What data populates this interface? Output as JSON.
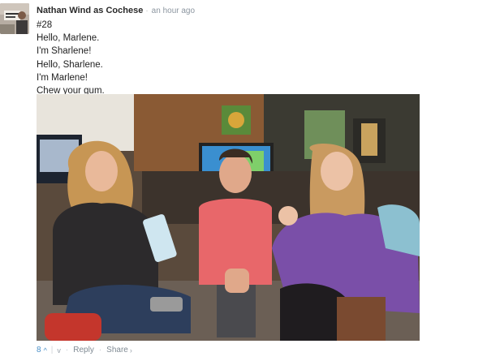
{
  "comment": {
    "author": "Nathan Wind as Cochese",
    "separator": "·",
    "timestamp": "an hour ago",
    "lines": [
      "#28",
      "Hello, Marlene.",
      "I'm Sharlene!",
      "Hello, Sharlene.",
      "I'm Marlene!",
      "Chew your gum."
    ],
    "avatar_icon": "user-avatar-photo",
    "image_icon": "embedded-photo"
  },
  "footer": {
    "vote_count": "8",
    "upvote_glyph": "^",
    "divider": "|",
    "downvote_glyph": "v",
    "bullet": "·",
    "reply_label": "Reply",
    "share_label": "Share",
    "share_chevron": "›"
  },
  "colors": {
    "link_blue": "#4a90c8",
    "meta_gray": "#8c96a0"
  }
}
